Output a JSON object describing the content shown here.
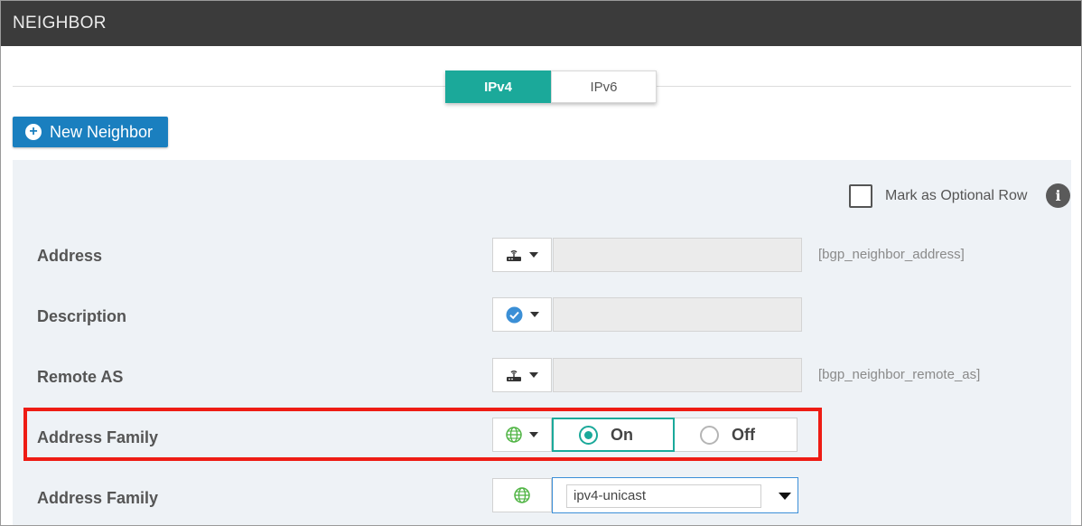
{
  "header": {
    "title": "NEIGHBOR"
  },
  "tabs": [
    {
      "label": "IPv4",
      "active": true
    },
    {
      "label": "IPv6",
      "active": false
    }
  ],
  "new_neighbor_label": "New Neighbor",
  "optional_row": {
    "label": "Mark as Optional Row",
    "checked": false
  },
  "rows": [
    {
      "label": "Address",
      "icon": "router-icon",
      "value": "",
      "hint": "[bgp_neighbor_address]"
    },
    {
      "label": "Description",
      "icon": "check-circle-icon",
      "value": "",
      "hint": ""
    },
    {
      "label": "Remote AS",
      "icon": "router-icon",
      "value": "",
      "hint": "[bgp_neighbor_remote_as]"
    },
    {
      "label": "Address Family",
      "icon": "globe-icon",
      "options": [
        "On",
        "Off"
      ],
      "selected": "On"
    },
    {
      "label": "Address Family",
      "icon": "globe-icon",
      "value": "ipv4-unicast"
    }
  ],
  "colors": {
    "accent": "#1ba99a",
    "primary_button": "#1a7fbf",
    "highlight": "#ee1c14",
    "globe": "#4fb443",
    "check": "#3b8fd6"
  }
}
